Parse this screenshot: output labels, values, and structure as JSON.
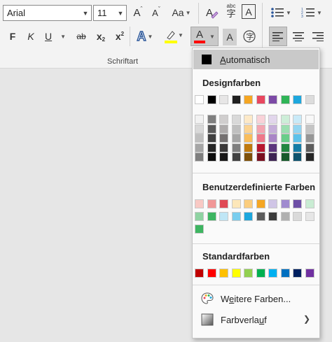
{
  "ribbon": {
    "font_name": "Arial",
    "font_size": "11",
    "group_label": "Schriftart",
    "grow_font": "A",
    "shrink_font": "A",
    "change_case": "Aa",
    "bold": "F",
    "italic": "K",
    "underline": "U",
    "strikethrough": "ab",
    "subscript": "x",
    "superscript": "x",
    "text_effects": "A",
    "font_color": "A",
    "char_shading": "A",
    "spell_label": "abc"
  },
  "panel": {
    "automatic_label_accel": "A",
    "automatic_label_rest": "utomatisch",
    "theme_title": "Designfarben",
    "custom_title": "Benutzerdefinierte Farben",
    "standard_title": "Standardfarben",
    "more_colors_pre": "W",
    "more_colors_accel": "e",
    "more_colors_post": "itere Farben...",
    "gradient_pre": "Farbverla",
    "gradient_accel": "u",
    "gradient_post": "f"
  },
  "colors": {
    "theme_top": [
      "#ffffff",
      "#000000",
      "#e7e6e6",
      "#1f1f1f",
      "#f5a623",
      "#e8475f",
      "#7c4aa6",
      "#2fb457",
      "#1ea7dd",
      "#dcdcdc"
    ],
    "theme_shades": [
      [
        "#f2f2f2",
        "#d9d9d9",
        "#bfbfbf",
        "#a6a6a6",
        "#7f7f7f"
      ],
      [
        "#7f7f7f",
        "#595959",
        "#3f3f3f",
        "#262626",
        "#0d0d0d"
      ],
      [
        "#d0cece",
        "#aeabab",
        "#757171",
        "#3a3838",
        "#171616"
      ],
      [
        "#d9d9d9",
        "#bfbfbf",
        "#a6a6a6",
        "#7f7f7f",
        "#404040"
      ],
      [
        "#fde9c8",
        "#fbd392",
        "#f9bd5b",
        "#c07a0e",
        "#7f510a"
      ],
      [
        "#f9d2d8",
        "#f3a5b1",
        "#ee788a",
        "#b81830",
        "#7a1020"
      ],
      [
        "#e2d6ec",
        "#c5aed9",
        "#a985c6",
        "#5c367d",
        "#3d2453"
      ],
      [
        "#cdeed8",
        "#9bdeb0",
        "#69cd89",
        "#238641",
        "#17592b"
      ],
      [
        "#c9eaf8",
        "#93d5f1",
        "#5dc1ea",
        "#157ca6",
        "#0e536e"
      ],
      [
        "#f8f8f8",
        "#c4c4c4",
        "#969696",
        "#5c5c5c",
        "#262626"
      ]
    ],
    "custom_row1": [
      "#f9c9c4",
      "#f19797",
      "#e04a55",
      "#fde7b9",
      "#fbcd7e",
      "#f5a623",
      "#d0c5e6",
      "#a08bcf",
      "#6e4fa6",
      "#c9ecd3"
    ],
    "custom_row2": [
      "#8fd3a2",
      "#3eb561",
      "#bfe6f6",
      "#79cdee",
      "#1ea7dd",
      "#5c5c5c",
      "#3c3c3c",
      "#b0b0b0",
      "#dadada",
      "#e6e6e6"
    ],
    "custom_row3": [
      "#3eb561"
    ],
    "standard": [
      "#c00000",
      "#ff0000",
      "#ffc000",
      "#ffff00",
      "#92d050",
      "#00b050",
      "#00b0f0",
      "#0070c0",
      "#002060",
      "#7030a0"
    ],
    "accent_blue": "#2b579a",
    "font_color_bar": "#ff0000",
    "highlight_bar": "#ffff00"
  },
  "icons": {
    "theme_grid": "swatch-grid",
    "palette": "palette-icon",
    "gradient": "gradient-icon"
  }
}
